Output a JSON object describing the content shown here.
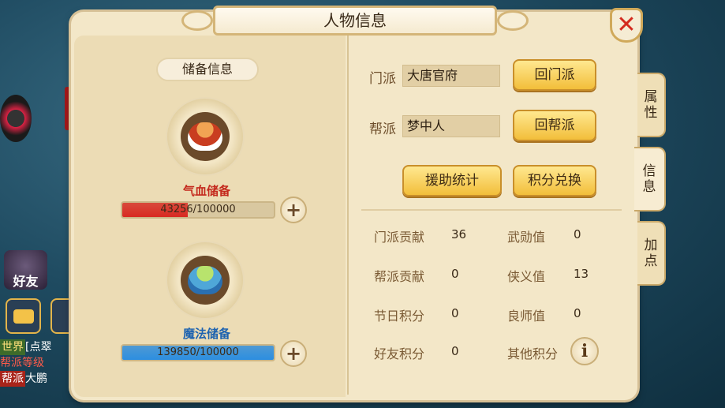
{
  "window": {
    "title": "人物信息"
  },
  "background": {
    "friend_label": "好友",
    "chat_lines": [
      {
        "tag": "世界",
        "text": "[点翠"
      },
      {
        "tag": "",
        "text": "帮派等级"
      },
      {
        "tag": "帮派",
        "text": "大鹏"
      }
    ]
  },
  "reserve": {
    "section_label": "储备信息",
    "hp": {
      "name": "气血储备",
      "text": "43256/100000",
      "value": 43256,
      "max": 100000,
      "color": "#d82a22"
    },
    "mp": {
      "name": "魔法储备",
      "text": "139850/100000",
      "value": 139850,
      "max": 100000,
      "color": "#2c8ee0"
    },
    "plus_icon": "+"
  },
  "info": {
    "sect_label": "门派",
    "sect_value": "大唐官府",
    "return_sect_button": "回门派",
    "guild_label": "帮派",
    "guild_value": "梦中人",
    "return_guild_button": "回帮派",
    "aid_stats_button": "援助统计",
    "points_exchange_button": "积分兑换",
    "stats": [
      {
        "label": "门派贡献",
        "value": "36"
      },
      {
        "label": "武勋值",
        "value": "0"
      },
      {
        "label": "帮派贡献",
        "value": "0"
      },
      {
        "label": "侠义值",
        "value": "13"
      },
      {
        "label": "节日积分",
        "value": "0"
      },
      {
        "label": "良师值",
        "value": "0"
      },
      {
        "label": "好友积分",
        "value": "0"
      },
      {
        "label": "其他积分",
        "value": ""
      }
    ],
    "info_icon": "i"
  },
  "tabs": [
    {
      "label": "属\n性",
      "active": false
    },
    {
      "label": "信\n息",
      "active": true
    },
    {
      "label": "加\n点",
      "active": false
    }
  ],
  "close_icon": "✕"
}
